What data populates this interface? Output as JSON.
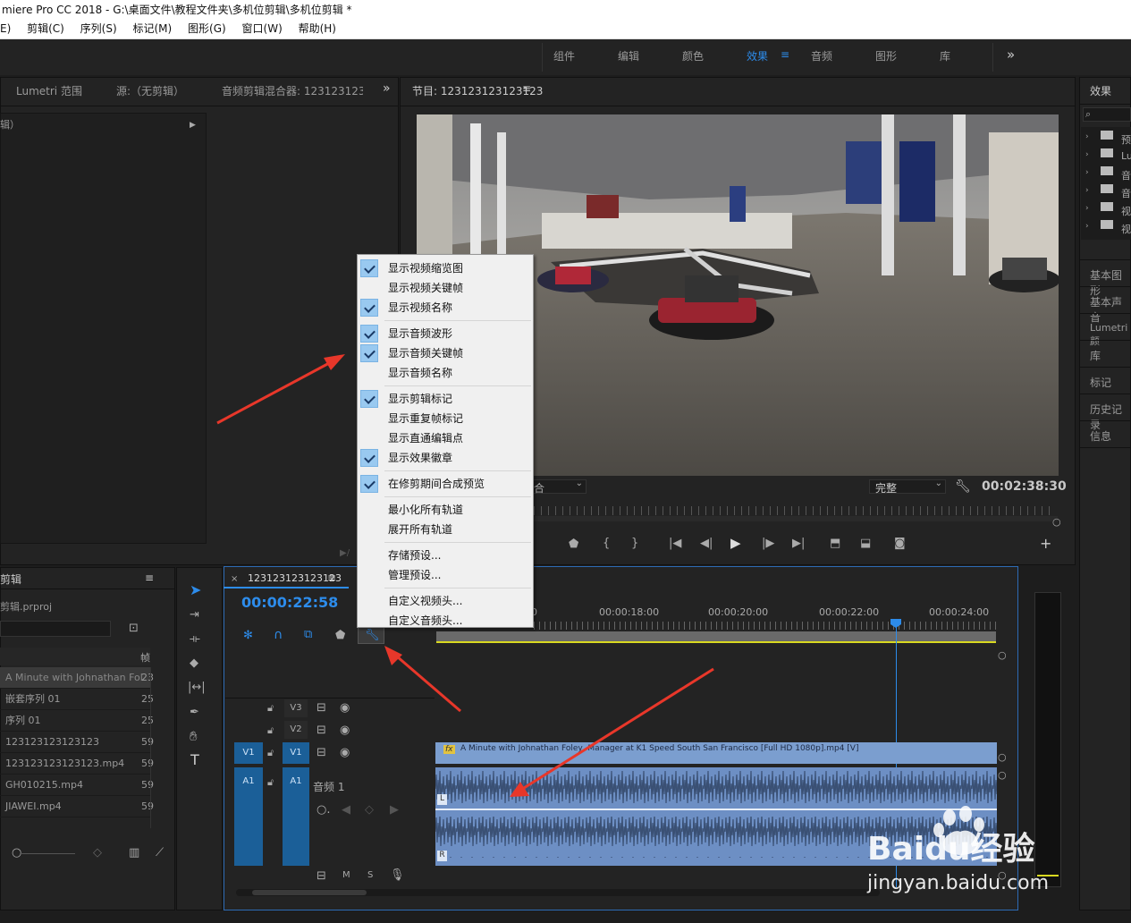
{
  "window": {
    "title": "miere Pro CC 2018 - G:\\桌面文件\\教程文件夹\\多机位剪辑\\多机位剪辑 *"
  },
  "menu": [
    "E)",
    "剪辑(C)",
    "序列(S)",
    "标记(M)",
    "图形(G)",
    "窗口(W)",
    "帮助(H)"
  ],
  "workspaces": {
    "items": [
      "组件",
      "编辑",
      "颜色",
      "效果",
      "音频",
      "图形",
      "库"
    ],
    "active": "效果",
    "more": "»"
  },
  "source_panel": {
    "tabs": [
      "Lumetri 范围",
      "源:（无剪辑）",
      "音频剪辑混合器: 123123123123"
    ],
    "more": "»",
    "clip_row": "辑）"
  },
  "program": {
    "title": "节目: 123123123123123",
    "fit_label": "合",
    "quality": "完整",
    "timecode": "00:02:38:30"
  },
  "effects_panel": {
    "title": "效果",
    "items": [
      "预",
      "Lu",
      "音",
      "音",
      "视",
      "视"
    ],
    "sections": [
      "基本图形",
      "基本声音",
      "Lumetri 颜",
      "库",
      "标记",
      "历史记录",
      "信息"
    ]
  },
  "project": {
    "title": "剪辑",
    "file": "剪辑.prproj",
    "column_header": "帧",
    "rows": [
      {
        "name": "A Minute with Johnathan Fol",
        "fps": "23"
      },
      {
        "name": "嵌套序列 01",
        "fps": "25"
      },
      {
        "name": "序列 01",
        "fps": "25"
      },
      {
        "name": "123123123123123",
        "fps": "59"
      },
      {
        "name": "123123123123123.mp4",
        "fps": "59"
      },
      {
        "name": "GH010215.mp4",
        "fps": "59"
      },
      {
        "name": "JIAWEI.mp4",
        "fps": "59"
      }
    ]
  },
  "timeline": {
    "tab": "123123123123123",
    "timecode": "00:00:22:58",
    "ruler": [
      "00:00:18:00",
      "00:00:20:00",
      "00:00:22:00",
      "00:00:24:00"
    ],
    "tracks": {
      "v3": "V3",
      "v2": "V2",
      "v1": "V1",
      "a1": "A1",
      "audio_name": "音频 1",
      "m": "M",
      "s": "S"
    },
    "video_clip": "A Minute with Johnathan Foley, Manager at K1 Speed South San Francisco [Full HD 1080p].mp4 [V]",
    "fx": "fx",
    "ch_l": "L",
    "ch_r": "R"
  },
  "context_menu": {
    "items": [
      {
        "label": "显示视频缩览图",
        "checked": true
      },
      {
        "label": "显示视频关键帧",
        "checked": false
      },
      {
        "label": "显示视频名称",
        "checked": true
      },
      {
        "label": "显示音频波形",
        "checked": true
      },
      {
        "label": "显示音频关键帧",
        "checked": true
      },
      {
        "label": "显示音频名称",
        "checked": false
      },
      {
        "label": "显示剪辑标记",
        "checked": true
      },
      {
        "label": "显示重复帧标记",
        "checked": false
      },
      {
        "label": "显示直通编辑点",
        "checked": false
      },
      {
        "label": "显示效果徽章",
        "checked": true
      },
      {
        "label": "在修剪期间合成预览",
        "checked": true
      },
      {
        "label": "最小化所有轨道",
        "checked": false
      },
      {
        "label": "展开所有轨道",
        "checked": false
      },
      {
        "label": "存储预设...",
        "checked": false
      },
      {
        "label": "管理预设...",
        "checked": false
      },
      {
        "label": "自定义视频头...",
        "checked": false
      },
      {
        "label": "自定义音频头...",
        "checked": false
      }
    ]
  },
  "watermark": {
    "brand": "Baidu经验",
    "url": "jingyan.baidu.com"
  },
  "colors": {
    "accent": "#2d8ceb",
    "clip_video": "#7b9ecf",
    "clip_audio": "#6d8fc4",
    "arrow": "#e8372a"
  }
}
